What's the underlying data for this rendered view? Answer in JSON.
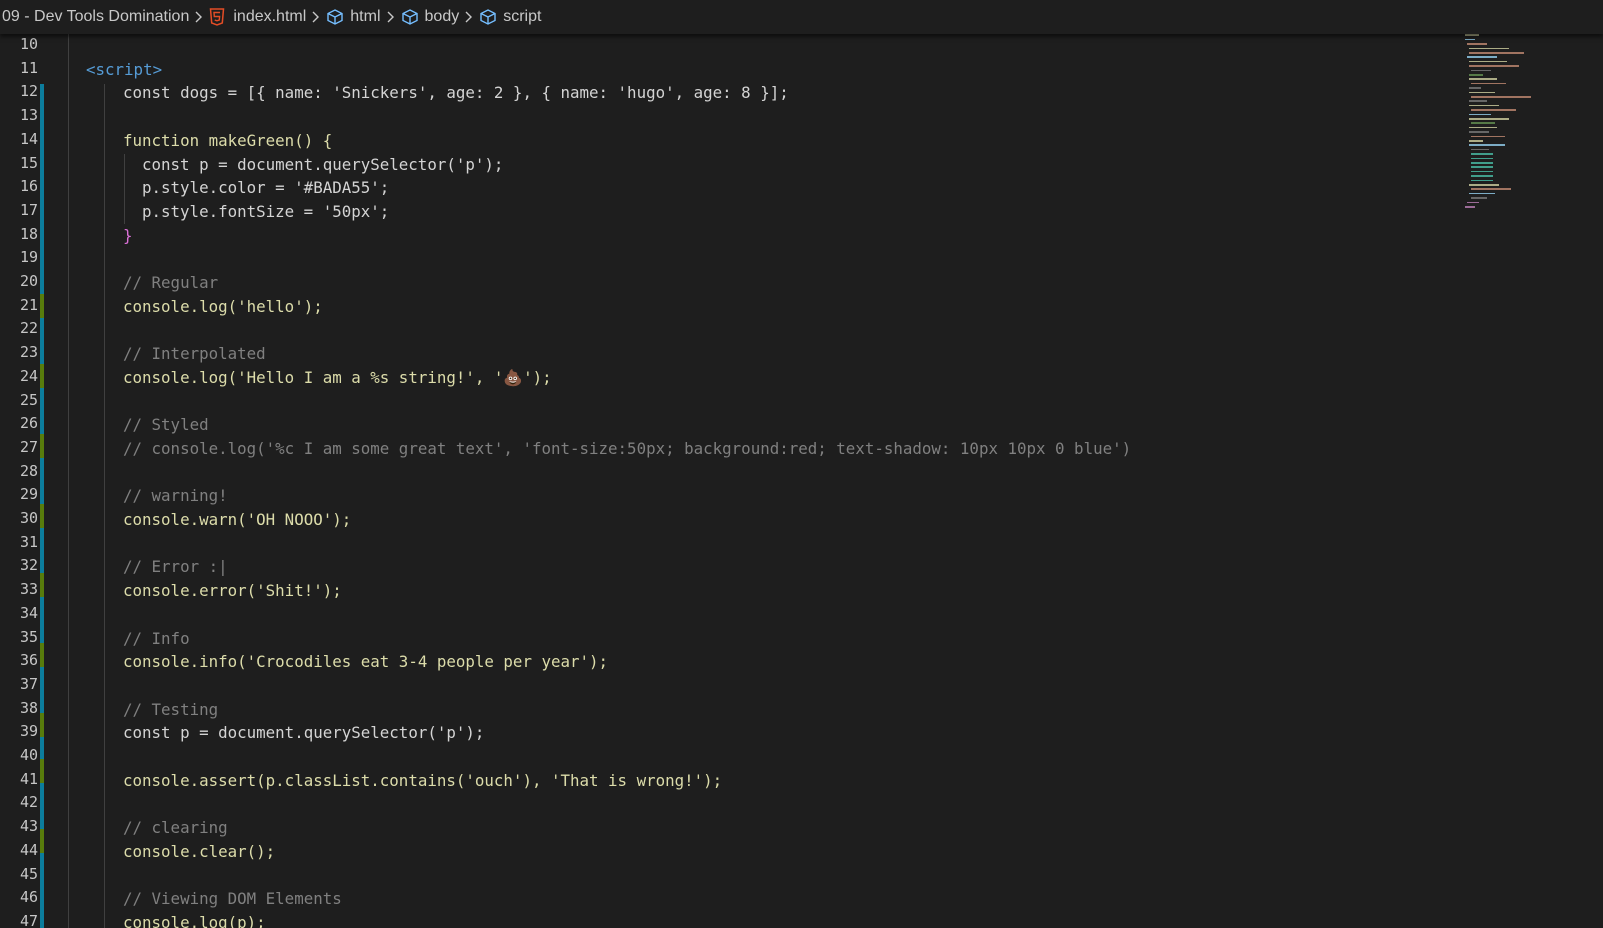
{
  "breadcrumbs": {
    "folder": "09 - Dev Tools Domination",
    "file": "index.html",
    "html": "html",
    "body": "body",
    "script": "script"
  },
  "icons": {
    "file_icon": "html5-file-icon",
    "element_icon": "cube-symbol-icon",
    "separator_icon": "chevron-right-icon"
  },
  "colors": {
    "background": "#1e1e1e",
    "git_added": "#0c7d9d",
    "git_modified": "#587c0c",
    "html5_icon": "#e44d26"
  },
  "line_numbers": [
    "10",
    "11",
    "12",
    "13",
    "14",
    "15",
    "16",
    "17",
    "18",
    "19",
    "20",
    "21",
    "22",
    "23",
    "24",
    "25",
    "26",
    "27",
    "28",
    "29",
    "30",
    "31",
    "32",
    "33",
    "34",
    "35",
    "36",
    "37",
    "38",
    "39",
    "40",
    "41",
    "42",
    "43",
    "44",
    "45",
    "46",
    "47"
  ],
  "code": {
    "l11": "<script>",
    "l12": "const dogs = [{ name: 'Snickers', age: 2 }, { name: 'hugo', age: 8 }];",
    "l14": "function makeGreen() {",
    "l15": "const p = document.querySelector('p');",
    "l16": "p.style.color = '#BADA55';",
    "l17": "p.style.fontSize = '50px';",
    "l18": "}",
    "l20": "// Regular",
    "l21": "console.log('hello');",
    "l23": "// Interpolated",
    "l24": "console.log('Hello I am a %s string!', '💩');",
    "l26": "// Styled",
    "l27": "// console.log('%c I am some great text', 'font-size:50px; background:red; text-shadow: 10px 10px 0 blue')",
    "l29": "// warning!",
    "l30": "console.warn('OH NOOO');",
    "l32": "// Error :|",
    "l33": "console.error('Shit!');",
    "l35": "// Info",
    "l36": "console.info('Crocodiles eat 3-4 people per year');",
    "l38": "// Testing",
    "l39": "const p = document.querySelector('p');",
    "l41": "console.assert(p.classList.contains('ouch'), 'That is wrong!');",
    "l43": "// clearing",
    "l44": "console.clear();",
    "l46": "// Viewing DOM Elements",
    "l47": "console.log(p);"
  }
}
